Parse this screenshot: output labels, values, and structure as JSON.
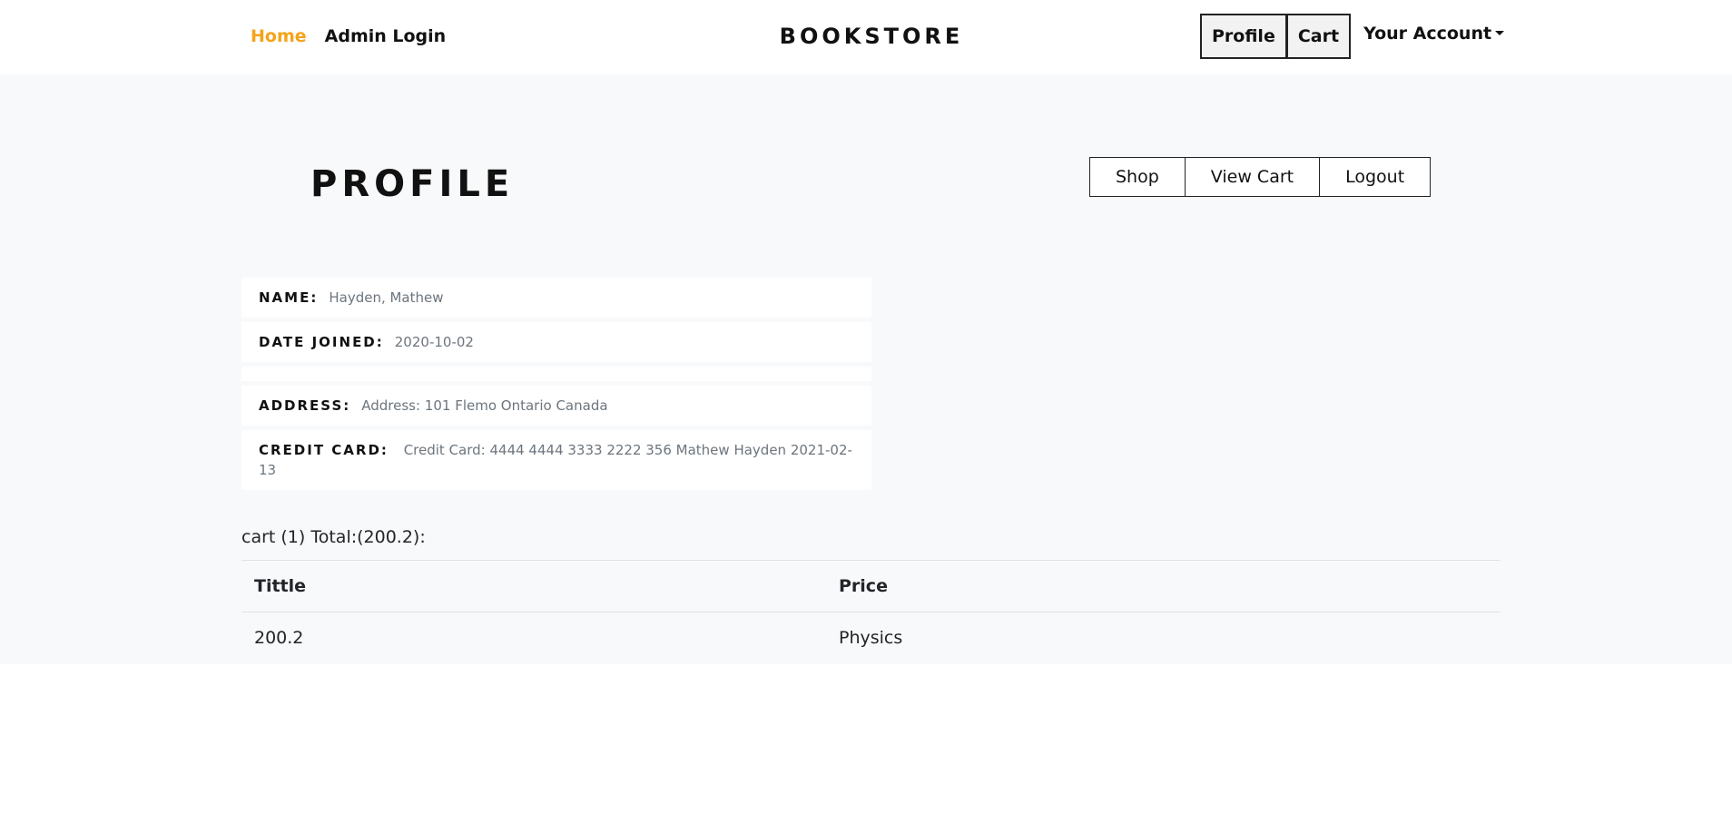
{
  "nav": {
    "home": "Home",
    "admin_login": "Admin Login",
    "brand": "BOOKSTORE",
    "profile_btn": "Profile",
    "cart_btn": "Cart",
    "account": "Your Account"
  },
  "page": {
    "title": "PROFILE",
    "actions": {
      "shop": "Shop",
      "view_cart": "View Cart",
      "logout": "Logout"
    }
  },
  "profile": {
    "name_label": "NAME:",
    "name_value": "Hayden, Mathew",
    "date_label": "DATE JOINED:",
    "date_value": "2020-10-02",
    "address_label": "ADDRESS:",
    "address_value": "Address: 101 Flemo Ontario Canada",
    "card_label": "CREDIT CARD:",
    "card_value": "Credit Card: 4444 4444 3333 2222 356 Mathew Hayden 2021-02-13"
  },
  "cart": {
    "summary": "cart (1) Total:(200.2):",
    "headers": [
      "Tittle",
      "Price"
    ],
    "rows": [
      [
        "200.2",
        "Physics"
      ]
    ]
  },
  "colors": {
    "accent": "#f5a31a",
    "main_bg": "#f8f9fa"
  }
}
